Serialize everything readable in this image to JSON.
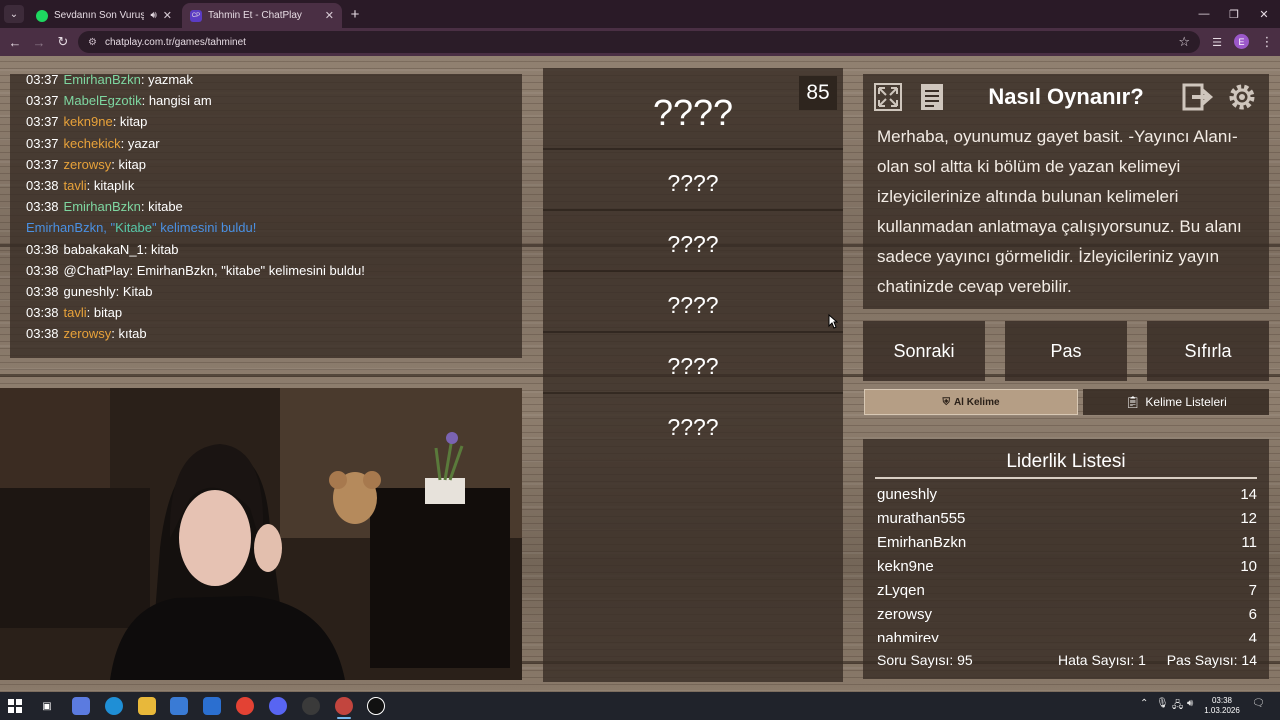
{
  "browser": {
    "tabs": [
      {
        "title": "Sevdanın Son Vuruşu • Tarik",
        "favicon_color": "#1ed760",
        "audio": true
      },
      {
        "title": "Tahmin Et - ChatPlay",
        "favicon_text": "CP",
        "active": true
      }
    ],
    "url": "chatplay.com.tr/games/tahminet",
    "profile_initial": "E"
  },
  "chat": {
    "messages": [
      {
        "time": "03:37",
        "user": "EmirhanBzkn",
        "color": "#7ed6a0",
        "text": ": yazmak"
      },
      {
        "time": "03:37",
        "user": "MabelEgzotik",
        "color": "#7ed6a0",
        "text": ": hangisi am"
      },
      {
        "time": "03:37",
        "user": "kekn9ne",
        "color": "#e8a23a",
        "text": ": kitap"
      },
      {
        "time": "03:37",
        "user": "kechekick",
        "color": "#e8a23a",
        "text": ": yazar"
      },
      {
        "time": "03:37",
        "user": "zerowsy",
        "color": "#e8a23a",
        "text": ": kitap"
      },
      {
        "time": "03:38",
        "user": "tavli",
        "color": "#e8a23a",
        "text": ": kitaplık"
      },
      {
        "time": "03:38",
        "user": "EmirhanBzkn",
        "color": "#7ed6a0",
        "text": ": kitabe"
      },
      {
        "system": true,
        "before": "EmirhanBzkn, \"",
        "highlight": "Kitabe",
        "after": "\" kelimesini buldu!"
      },
      {
        "time": "03:38",
        "user": "babakakaN_1",
        "color": "#ffffff",
        "text": ": kitab"
      },
      {
        "time": "03:38",
        "user": "@ChatPlay",
        "color": "#ffffff",
        "text": ": EmirhanBzkn, \"kitabe\" kelimesini buldu!"
      },
      {
        "time": "03:38",
        "user": "guneshly",
        "color": "#ffffff",
        "text": ": Kitab"
      },
      {
        "time": "03:38",
        "user": "tavli",
        "color": "#e8a23a",
        "text": ": bitap"
      },
      {
        "time": "03:38",
        "user": "zerowsy",
        "color": "#e8a23a",
        "text": ": kıtab"
      }
    ]
  },
  "words": {
    "counter": "85",
    "main": "????",
    "forbidden": [
      "????",
      "????",
      "????",
      "????",
      "????"
    ]
  },
  "howto": {
    "title": "Nasıl Oynanır?",
    "text": "Merhaba, oyunumuz gayet basit. -Yayıncı Alanı- olan sol altta ki bölüm de yazan kelimeyi izleyicilerinize altında bulunan kelimeleri kullanmadan anlatmaya çalışıyorsunuz. Bu alanı sadece yayıncı görmelidir. İzleyicileriniz yayın chatinizde cevap verebilir."
  },
  "actions": {
    "next": "Sonraki",
    "pass": "Pas",
    "reset": "Sıfırla",
    "ai_word": "Al Kelime",
    "word_lists": "Kelime Listeleri"
  },
  "leaderboard": {
    "title": "Liderlik Listesi",
    "rows": [
      {
        "name": "guneshly",
        "score": "14"
      },
      {
        "name": "murathan555",
        "score": "12"
      },
      {
        "name": "EmirhanBzkn",
        "score": "11"
      },
      {
        "name": "kekn9ne",
        "score": "10"
      },
      {
        "name": "zLyqen",
        "score": "7"
      },
      {
        "name": "zerowsy",
        "score": "6"
      },
      {
        "name": "nahmirey",
        "score": "4"
      }
    ],
    "stats": {
      "questions": "Soru Sayısı: 95",
      "errors": "Hata Sayısı: 1",
      "passes": "Pas Sayısı: 14"
    }
  },
  "taskbar": {
    "time": "03:38",
    "date": "1.03.2026"
  }
}
